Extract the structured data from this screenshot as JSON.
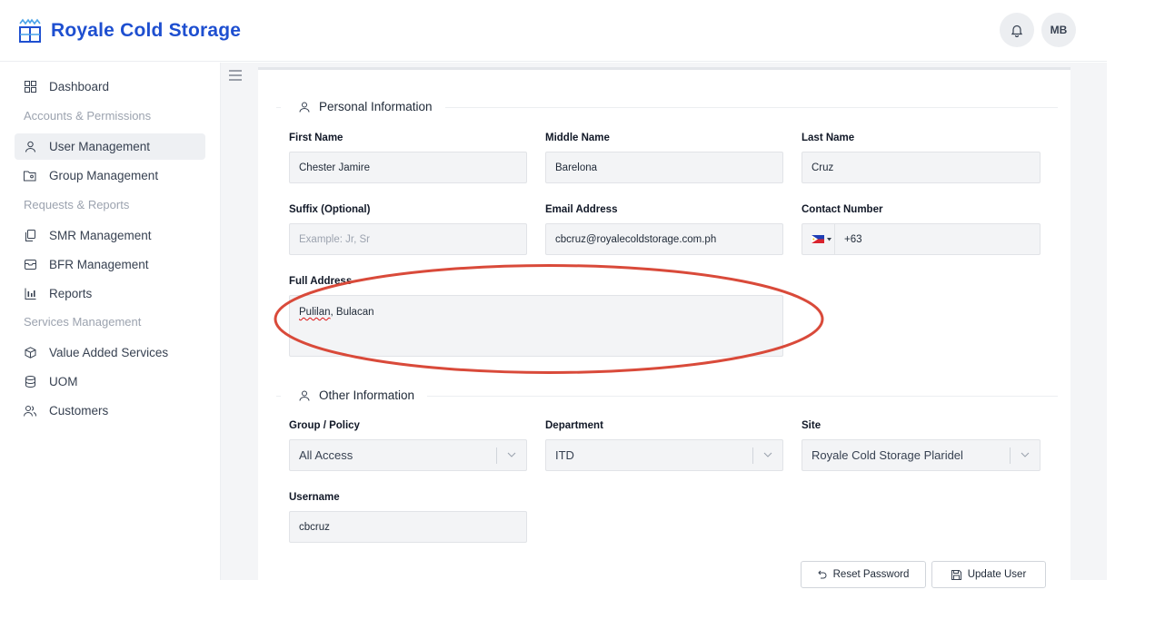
{
  "header": {
    "brand_name": "Royale Cold Storage",
    "avatar_initials": "MB"
  },
  "sidebar": {
    "dashboard": "Dashboard",
    "section_accounts": "Accounts & Permissions",
    "user_management": "User Management",
    "group_management": "Group Management",
    "section_requests": "Requests & Reports",
    "smr_management": "SMR Management",
    "bfr_management": "BFR Management",
    "reports": "Reports",
    "section_services": "Services Management",
    "value_added_services": "Value Added Services",
    "uom": "UOM",
    "customers": "Customers"
  },
  "personal": {
    "title": "Personal Information",
    "first_name_label": "First Name",
    "first_name": "Chester Jamire",
    "middle_name_label": "Middle Name",
    "middle_name": "Barelona",
    "last_name_label": "Last Name",
    "last_name": "Cruz",
    "suffix_label": "Suffix (Optional)",
    "suffix_placeholder": "Example: Jr, Sr",
    "email_label": "Email Address",
    "email": "cbcruz@royalecoldstorage.com.ph",
    "contact_label": "Contact Number",
    "contact_prefix": "+63",
    "address_label": "Full Address",
    "address_word1": "Pulilan",
    "address_rest": ", Bulacan"
  },
  "other": {
    "title": "Other Information",
    "group_label": "Group / Policy",
    "group_value": "All Access",
    "department_label": "Department",
    "department_value": "ITD",
    "site_label": "Site",
    "site_value": "Royale Cold Storage Plaridel",
    "username_label": "Username",
    "username": "cbcruz"
  },
  "actions": {
    "reset_password": "Reset Password",
    "update_user": "Update User"
  },
  "colors": {
    "brand": "#1e4fd0",
    "annotation": "#d94a3a"
  }
}
